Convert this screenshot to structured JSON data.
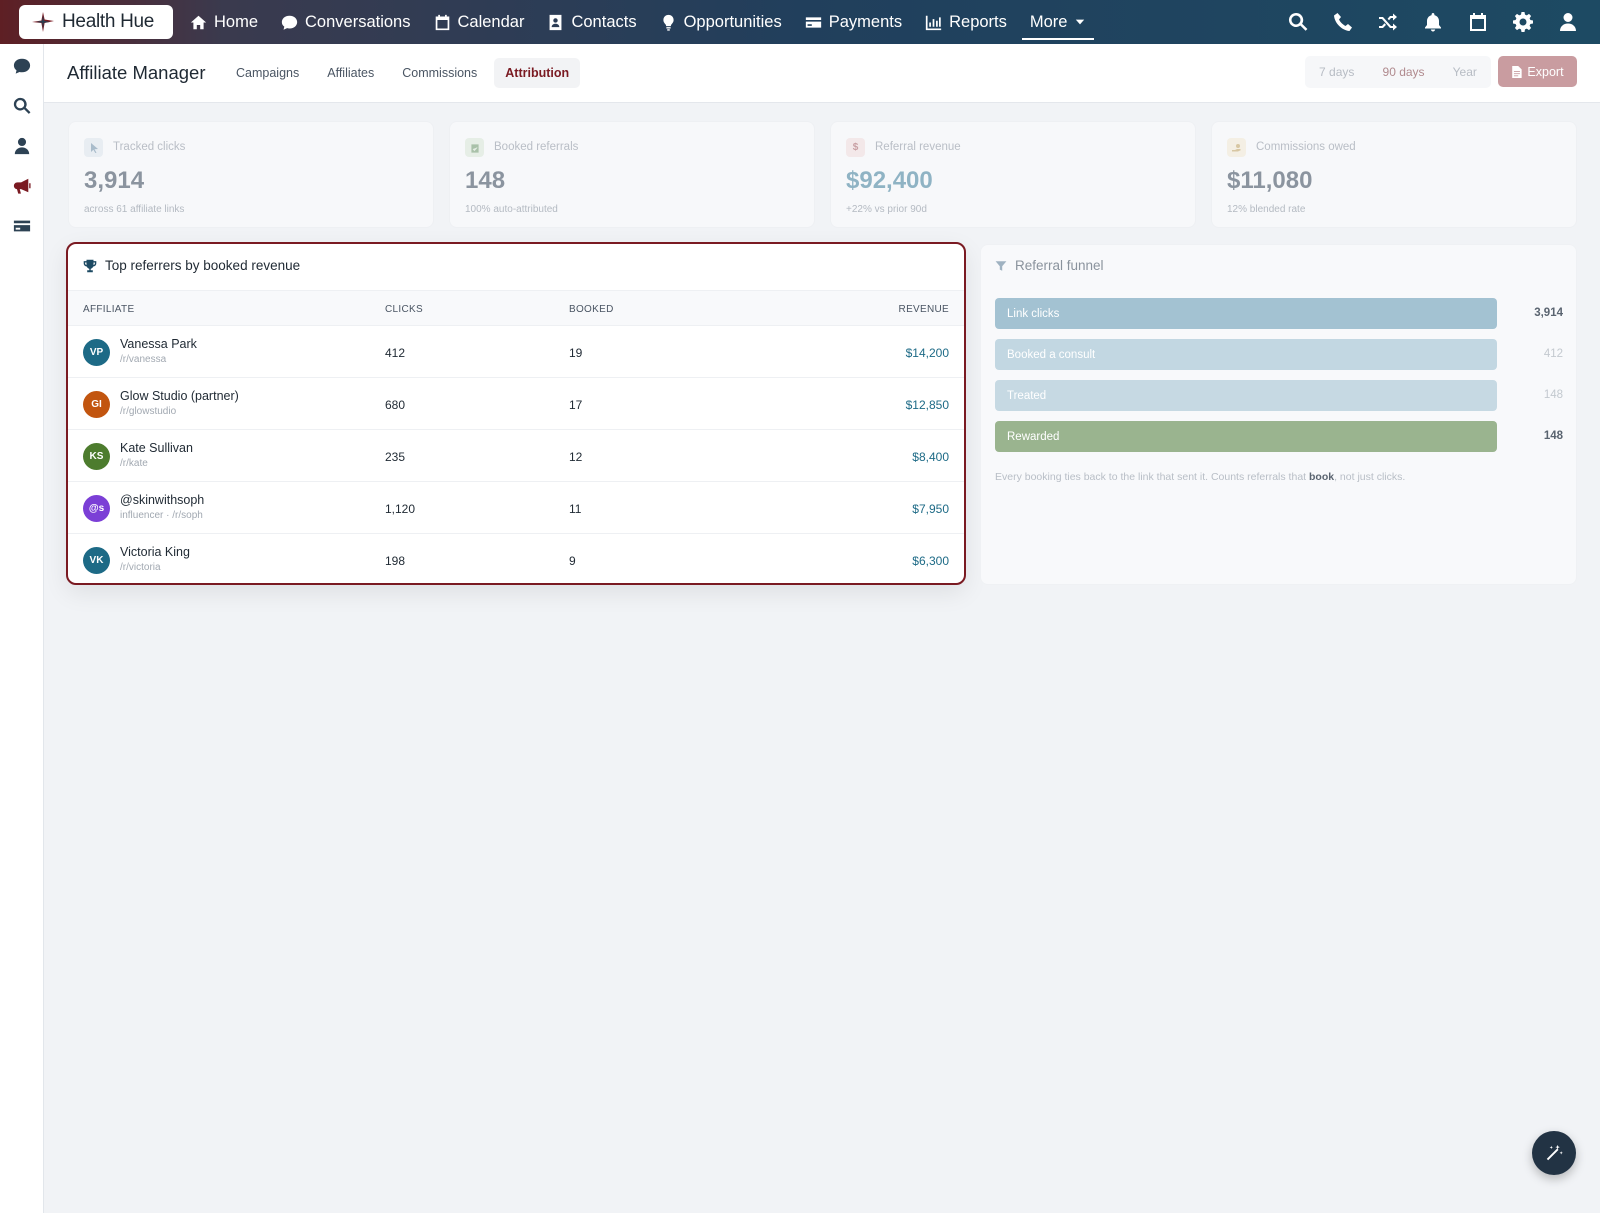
{
  "brand": {
    "name": "Health Hue"
  },
  "nav": {
    "links": [
      {
        "label": "Home",
        "icon": "home-icon"
      },
      {
        "label": "Conversations",
        "icon": "chat-icon"
      },
      {
        "label": "Calendar",
        "icon": "calendar-icon"
      },
      {
        "label": "Contacts",
        "icon": "contact-card-icon"
      },
      {
        "label": "Opportunities",
        "icon": "lightbulb-icon"
      },
      {
        "label": "Payments",
        "icon": "credit-card-icon"
      },
      {
        "label": "Reports",
        "icon": "bar-chart-icon"
      },
      {
        "label": "More",
        "icon": "caret-down-icon"
      }
    ],
    "right_icons": [
      "search-icon",
      "phone-icon",
      "shuffle-icon",
      "bell-icon",
      "calendar-icon",
      "gear-icon",
      "user-icon"
    ]
  },
  "rail": {
    "icons": [
      "chat-icon",
      "search-icon",
      "user-icon",
      "megaphone-icon",
      "credit-card-icon"
    ],
    "active": "megaphone-icon"
  },
  "header": {
    "title": "Affiliate Manager",
    "tabs": [
      "Campaigns",
      "Affiliates",
      "Commissions",
      "Attribution"
    ],
    "active_tab": "Attribution",
    "ranges": [
      "7 days",
      "90 days",
      "Year"
    ],
    "selected_range": "90 days",
    "export_label": "Export"
  },
  "metrics": [
    {
      "label": "Tracked clicks",
      "value": "3,914",
      "sub": "across 61 affiliate links",
      "icon": "cursor-icon"
    },
    {
      "label": "Booked referrals",
      "value": "148",
      "sub": "100% auto-attributed",
      "icon": "calendar-check-icon"
    },
    {
      "label": "Referral revenue",
      "value": "$92,400",
      "sub": "+22% vs prior 90d",
      "icon": "dollar-icon"
    },
    {
      "label": "Commissions owed",
      "value": "$11,080",
      "sub": "12% blended rate",
      "icon": "hand-coin-icon"
    }
  ],
  "referrers": {
    "title": "Top referrers by booked revenue",
    "columns": [
      "AFFILIATE",
      "CLICKS",
      "BOOKED",
      "REVENUE"
    ],
    "rows": [
      {
        "initials": "VP",
        "name": "Vanessa Park",
        "handle": "/r/vanessa",
        "clicks": "412",
        "booked": "19",
        "revenue": "$14,200",
        "color": "#1d6a86"
      },
      {
        "initials": "GI",
        "name": "Glow Studio (partner)",
        "handle": "/r/glowstudio",
        "clicks": "680",
        "booked": "17",
        "revenue": "$12,850",
        "color": "#c2550f"
      },
      {
        "initials": "KS",
        "name": "Kate Sullivan",
        "handle": "/r/kate",
        "clicks": "235",
        "booked": "12",
        "revenue": "$8,400",
        "color": "#4d7c2e"
      },
      {
        "initials": "@s",
        "name": "@skinwithsoph",
        "handle": "influencer · /r/soph",
        "clicks": "1,120",
        "booked": "11",
        "revenue": "$7,950",
        "color": "#7b3fd6"
      },
      {
        "initials": "VK",
        "name": "Victoria King",
        "handle": "/r/victoria",
        "clicks": "198",
        "booked": "9",
        "revenue": "$6,300",
        "color": "#1d6a86"
      }
    ]
  },
  "funnel": {
    "title": "Referral funnel",
    "stages": [
      {
        "label": "Link clicks",
        "value": "3,914",
        "color": "#a3c2d2",
        "fill": 1.0
      },
      {
        "label": "Booked a consult",
        "value": "412",
        "color": "#c2d7e2",
        "fill": 1.0
      },
      {
        "label": "Treated",
        "value": "148",
        "color": "#c6d9e3",
        "fill": 1.0
      },
      {
        "label": "Rewarded",
        "value": "148",
        "color": "#9ab48f",
        "fill": 1.0
      }
    ],
    "note_prefix": "Every booking ties back to the link that sent it. Counts referrals that ",
    "note_bold": "book",
    "note_suffix": ", not just clicks."
  },
  "colors": {
    "brand_maroon": "#7a1a22",
    "nav_blue": "#1d4a63",
    "revenue_teal": "#1d6a86"
  }
}
